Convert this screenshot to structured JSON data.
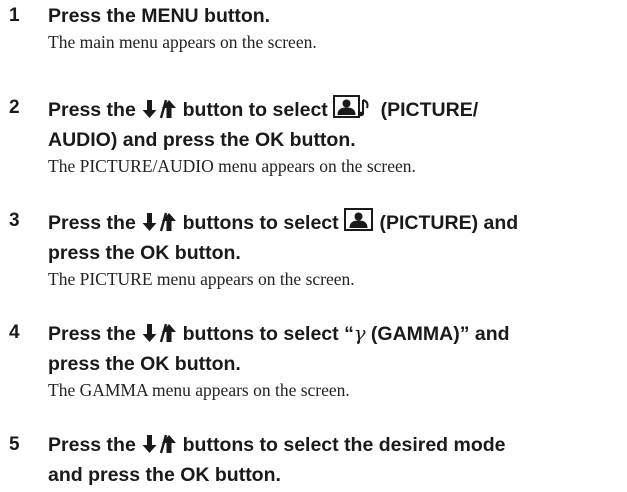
{
  "steps": [
    {
      "number": "1",
      "instruction": {
        "t1": "Press the MENU button."
      },
      "result": "The main menu appears on the screen."
    },
    {
      "number": "2",
      "instruction": {
        "t1": "Press the ",
        "t2": " button to select ",
        "t3": " (PICTURE/",
        "t4": "AUDIO) and press the OK button."
      },
      "icons": [
        "down-up-arrow-icon",
        "picture-audio-icon"
      ],
      "result": "The PICTURE/AUDIO menu appears on the screen."
    },
    {
      "number": "3",
      "instruction": {
        "t1": "Press the ",
        "t2": " buttons to select ",
        "t3": " (PICTURE) and",
        "t4": "press the OK button."
      },
      "icons": [
        "down-up-arrow-icon",
        "picture-icon"
      ],
      "result": "The PICTURE menu appears on the screen."
    },
    {
      "number": "4",
      "instruction": {
        "t1": "Press the ",
        "t2": " buttons to select “",
        "t3": "γ",
        "t4": " (GAMMA)” and",
        "t5": "press the OK button."
      },
      "icons": [
        "down-up-arrow-icon"
      ],
      "result": "The GAMMA menu appears on the screen."
    },
    {
      "number": "5",
      "instruction": {
        "t1": "Press the ",
        "t2": " buttons to select the desired mode",
        "t3": "and press the OK button."
      },
      "icons": [
        "down-up-arrow-icon"
      ]
    }
  ]
}
